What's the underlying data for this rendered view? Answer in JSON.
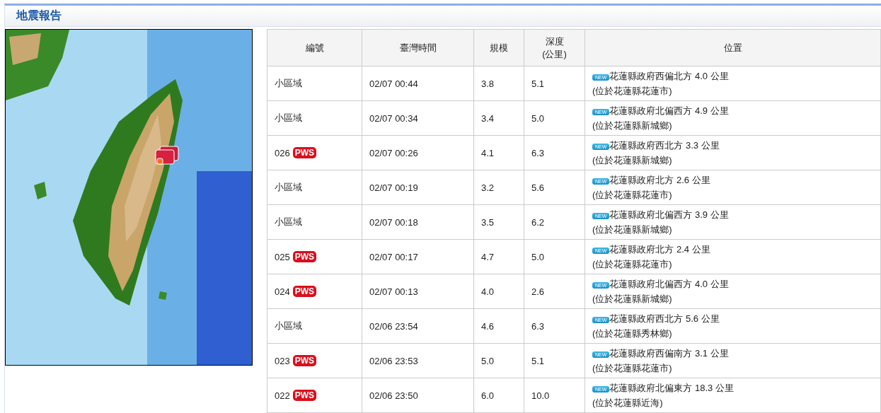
{
  "panel": {
    "title": "地震報告"
  },
  "table": {
    "columns": [
      "編號",
      "臺灣時間",
      "規模",
      "深度\n(公里)",
      "位置"
    ],
    "rows": [
      {
        "id": "小區域",
        "time": "02/07 00:44",
        "magnitude": "3.8",
        "depth": "5.1",
        "badge": "NEW",
        "location": "花蓮縣政府西偏北方 4.0 公里",
        "area": "(位於花蓮縣花蓮市)"
      },
      {
        "id": "小區域",
        "time": "02/07 00:34",
        "magnitude": "3.4",
        "depth": "5.0",
        "badge": "NEW",
        "location": "花蓮縣政府北偏西方 4.9 公里",
        "area": "(位於花蓮縣新城鄉)"
      },
      {
        "id": "026",
        "alert": "PWS",
        "time": "02/07 00:26",
        "magnitude": "4.1",
        "depth": "6.3",
        "badge": "NEW",
        "location": "花蓮縣政府西北方 3.3 公里",
        "area": "(位於花蓮縣新城鄉)"
      },
      {
        "id": "小區域",
        "time": "02/07 00:19",
        "magnitude": "3.2",
        "depth": "5.6",
        "badge": "NEW",
        "location": "花蓮縣政府北方 2.6 公里",
        "area": "(位於花蓮縣花蓮市)"
      },
      {
        "id": "小區域",
        "time": "02/07 00:18",
        "magnitude": "3.5",
        "depth": "6.2",
        "badge": "NEW",
        "location": "花蓮縣政府北偏西方 3.9 公里",
        "area": "(位於花蓮縣新城鄉)"
      },
      {
        "id": "025",
        "alert": "PWS",
        "time": "02/07 00:17",
        "magnitude": "4.7",
        "depth": "5.0",
        "badge": "NEW",
        "location": "花蓮縣政府北方 2.4 公里",
        "area": "(位於花蓮縣花蓮市)"
      },
      {
        "id": "024",
        "alert": "PWS",
        "time": "02/07 00:13",
        "magnitude": "4.0",
        "depth": "2.6",
        "badge": "NEW",
        "location": "花蓮縣政府北偏西方 4.0 公里",
        "area": "(位於花蓮縣新城鄉)"
      },
      {
        "id": "小區域",
        "time": "02/06 23:54",
        "magnitude": "4.6",
        "depth": "6.3",
        "badge": "NEW",
        "location": "花蓮縣政府西北方 5.6 公里",
        "area": "(位於花蓮縣秀林鄉)"
      },
      {
        "id": "023",
        "alert": "PWS",
        "time": "02/06 23:53",
        "magnitude": "5.0",
        "depth": "5.1",
        "badge": "NEW",
        "location": "花蓮縣政府西偏南方 3.1 公里",
        "area": "(位於花蓮縣花蓮市)"
      },
      {
        "id": "022",
        "alert": "PWS",
        "time": "02/06 23:50",
        "magnitude": "6.0",
        "depth": "10.0",
        "badge": "NEW",
        "location": "花蓮縣政府北偏東方 18.3 公里",
        "area": "(位於花蓮縣近海)"
      }
    ]
  }
}
